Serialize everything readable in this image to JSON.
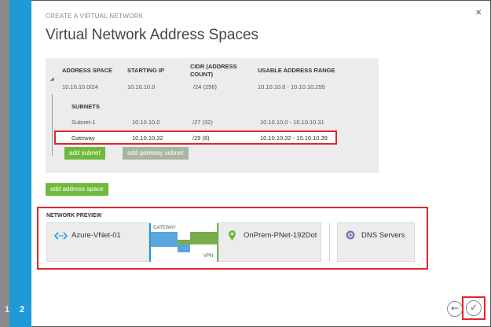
{
  "wizard": {
    "eyebrow": "CREATE A VIRTUAL NETWORK",
    "title": "Virtual Network Address Spaces",
    "steps": [
      "1",
      "2"
    ],
    "close_glyph": "×"
  },
  "address_space_table": {
    "headers": {
      "address_space": "ADDRESS SPACE",
      "starting_ip": "STARTING IP",
      "cidr_line1": "CIDR (ADDRESS",
      "cidr_line2": "COUNT)",
      "usable_range": "USABLE ADDRESS RANGE"
    },
    "space": {
      "address_space": "10.10.10.0/24",
      "starting_ip": "10.10.10.0",
      "cidr": "/24 (256)",
      "usable_range": "10.10.10.0 - 10.10.10.255"
    },
    "subnets_label": "SUBNETS",
    "subnets": [
      {
        "name": "Subnet-1",
        "starting_ip": "10.10.10.0",
        "cidr": "/27 (32)",
        "usable_range": "10.10.10.0 - 10.10.10.31"
      },
      {
        "name": "Gateway",
        "starting_ip": "10.10.10.32",
        "cidr": "/29 (8)",
        "usable_range": "10.10.10.32 - 10.10.10.39"
      }
    ],
    "add_subnet_label": "add subnet",
    "add_gateway_subnet_label": "add gateway subnet"
  },
  "add_address_space_label": "add address space",
  "network_preview": {
    "label": "NETWORK PREVIEW",
    "vnet_name": "Azure-VNet-01",
    "gateway_label": "GATEWAY",
    "vpn_label": "VPN",
    "local_network_name": "OnPrem-PNet-192Dot",
    "dns_label": "DNS Servers"
  },
  "navigation": {
    "back_glyph": "←",
    "complete_glyph": "✓"
  },
  "colors": {
    "accent_blue": "#1e9bd7",
    "button_green": "#6fba3d",
    "highlight_red": "#e0262d",
    "vpn_blue": "#5ba6dd",
    "vpn_green": "#79ad4a"
  }
}
